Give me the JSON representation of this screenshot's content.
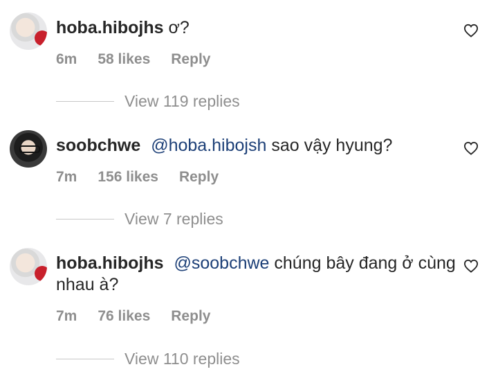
{
  "comments": [
    {
      "username": "hoba.hibojhs",
      "mention": "",
      "text": "ơ?",
      "time": "6m",
      "likes": "58 likes",
      "reply": "Reply",
      "view_replies": "View 119 replies"
    },
    {
      "username": "soobchwe",
      "mention": "@hoba.hibojsh",
      "text": "sao vậy hyung?",
      "time": "7m",
      "likes": "156 likes",
      "reply": "Reply",
      "view_replies": "View 7 replies"
    },
    {
      "username": "hoba.hibojhs",
      "mention": "@soobchwe",
      "text": "chúng bây đang ở cùng nhau à?",
      "time": "7m",
      "likes": "76 likes",
      "reply": "Reply",
      "view_replies": "View 110 replies"
    }
  ],
  "icons": {
    "like": "heart-outline-icon"
  },
  "colors": {
    "mention": "#1c3f77",
    "muted": "#8e8e8e",
    "text": "#262626"
  }
}
